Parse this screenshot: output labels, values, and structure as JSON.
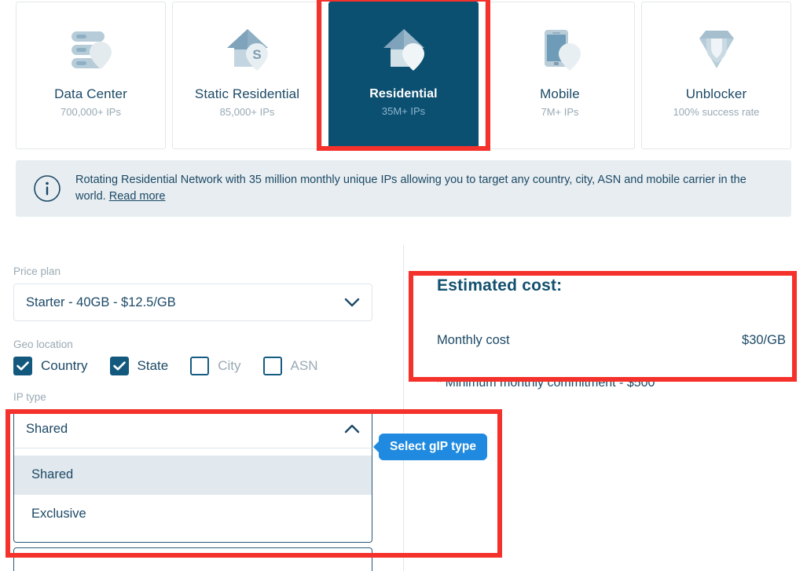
{
  "products": [
    {
      "id": "data-center",
      "icon": "server-stack-pin-icon",
      "title": "Data Center",
      "subtitle": "700,000+ IPs",
      "selected": false
    },
    {
      "id": "static-residential",
      "icon": "house-s-pin-icon",
      "title": "Static Residential",
      "subtitle": "85,000+ IPs",
      "selected": false
    },
    {
      "id": "residential",
      "icon": "house-pin-icon",
      "title": "Residential",
      "subtitle": "35M+ IPs",
      "selected": true
    },
    {
      "id": "mobile",
      "icon": "phone-pin-icon",
      "title": "Mobile",
      "subtitle": "7M+ IPs",
      "selected": false
    },
    {
      "id": "unblocker",
      "icon": "diamond-shield-icon",
      "title": "Unblocker",
      "subtitle": "100% success rate",
      "selected": false
    }
  ],
  "banner": {
    "icon": "info-circle-icon",
    "text": "Rotating Residential Network with 35 million monthly unique IPs allowing you to target any country, city, ASN and mobile carrier in the world.",
    "link_label": "Read more"
  },
  "form": {
    "price_plan": {
      "label": "Price plan",
      "value": "Starter - 40GB - $12.5/GB",
      "chevron": "chevron-down-icon"
    },
    "geo_location": {
      "label": "Geo location",
      "options": [
        {
          "label": "Country",
          "checked": true
        },
        {
          "label": "State",
          "checked": true
        },
        {
          "label": "City",
          "checked": false
        },
        {
          "label": "ASN",
          "checked": false
        }
      ]
    },
    "ip_type": {
      "label": "IP type",
      "value": "Shared",
      "chevron": "chevron-up-icon",
      "expanded": true,
      "options": [
        {
          "label": "Shared",
          "active": true
        },
        {
          "label": "Exclusive",
          "active": false
        }
      ]
    }
  },
  "summary": {
    "title": "Estimated cost:",
    "cost_label": "Monthly cost",
    "cost_value": "$30/GB",
    "note": "* Minimum monthly commitment - $500"
  },
  "tooltip": {
    "text": "Select gIP type"
  },
  "colors": {
    "selected_card_bg": "#0b4f71",
    "banner_bg": "#e7edf0",
    "text_primary": "#1c4966",
    "text_muted": "#9aa9b3",
    "tooltip_bg": "#1f8ae0",
    "annotation": "#f5312b",
    "checkbox_checked": "#13597e"
  }
}
